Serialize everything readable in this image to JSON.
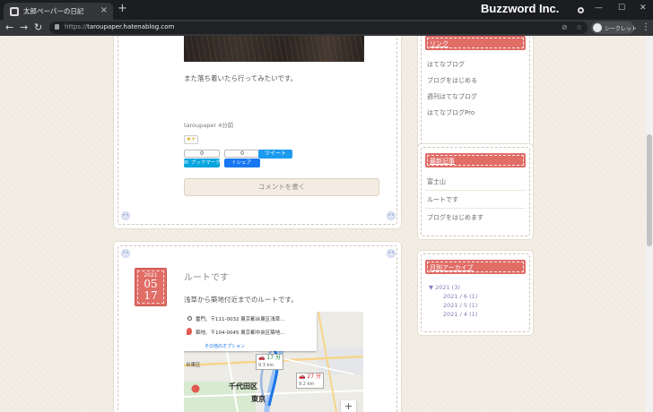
{
  "browser": {
    "tab_title": "太郎ペーパーの日記",
    "tab_close": "×",
    "new_tab": "+",
    "watermark": "Buzzword Inc.",
    "url_prefix": "https://",
    "url_host": "taroupaper.hatenablog.com",
    "profile_label": "シークレット",
    "icons": [
      "back-icon",
      "forward-icon",
      "reload-icon",
      "lock-icon",
      "eye-off-icon",
      "star-icon",
      "kebab-icon",
      "minimize-icon",
      "maximize-icon",
      "close-icon"
    ]
  },
  "article1": {
    "text": "また落ち着いたら行ってみたいです。",
    "author_time": "taroupaper 4分前",
    "star_label": "★+",
    "hatena_count": "0",
    "hatena_label": "B! ブックマーク",
    "fb_count": "0",
    "fb_label": "f シェア",
    "tweet_label": "ツイート",
    "comment_button": "コメントを書く"
  },
  "article2": {
    "date_year": "2021",
    "date_month": "05",
    "date_day": "17",
    "title": "ルートです",
    "text": "浅草から築地付近までのルートです。",
    "map": {
      "from": "雷門、〒111-0032 東京都台東区浅草...",
      "to": "築地、〒104-0045 東京都中央区築地...",
      "more": "その他のオプション",
      "route1_time": "17 分",
      "route1_dist": "9.3 km",
      "route2_time": "27 分",
      "route2_dist": "9.2 km",
      "labels": [
        "千代田区",
        "東京",
        "台東区"
      ],
      "zoom": "+"
    }
  },
  "sidebar": {
    "links_title": "リンク",
    "links": [
      "はてなブログ",
      "ブログをはじめる",
      "週刊はてなブログ",
      "はてなブログPro"
    ],
    "recent_title": "最新記事",
    "recent": [
      "富士山",
      "ルートです",
      "ブログをはじめます"
    ],
    "archive_title": "月別アーカイブ",
    "archive_year": "▼ 2021 (3)",
    "archive_months": [
      "2021 / 6 (1)",
      "2021 / 5 (1)",
      "2021 / 4 (1)"
    ]
  },
  "colors": {
    "accent": "#e06d66",
    "page_bg": "#f1ebe1",
    "archive_link": "#8b7ab8"
  }
}
